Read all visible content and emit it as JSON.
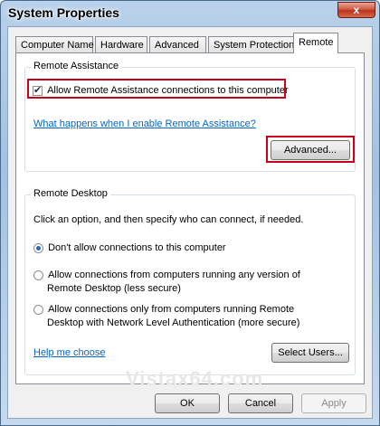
{
  "window": {
    "title": "System Properties",
    "close_label": "x"
  },
  "tabs": [
    {
      "label": "Computer Name"
    },
    {
      "label": "Hardware"
    },
    {
      "label": "Advanced"
    },
    {
      "label": "System Protection"
    },
    {
      "label": "Remote"
    }
  ],
  "remote_assistance": {
    "group_title": "Remote Assistance",
    "allow_checkbox_label": "Allow Remote Assistance connections to this computer",
    "allow_checked": true,
    "help_link": "What happens when I enable Remote Assistance?",
    "advanced_button": "Advanced..."
  },
  "remote_desktop": {
    "group_title": "Remote Desktop",
    "instruction": "Click an option, and then specify who can connect, if needed.",
    "options": [
      {
        "line1": "Don't allow connections to this computer",
        "line2": "",
        "selected": true
      },
      {
        "line1": "Allow connections from computers running any version of",
        "line2": "Remote Desktop (less secure)",
        "selected": false
      },
      {
        "line1": "Allow connections only from computers running Remote",
        "line2": "Desktop with Network Level Authentication (more secure)",
        "selected": false
      }
    ],
    "help_link": "Help me choose",
    "select_users_button": "Select Users..."
  },
  "footer": {
    "ok": "OK",
    "cancel": "Cancel",
    "apply": "Apply"
  },
  "watermark": "Vistax64.com"
}
